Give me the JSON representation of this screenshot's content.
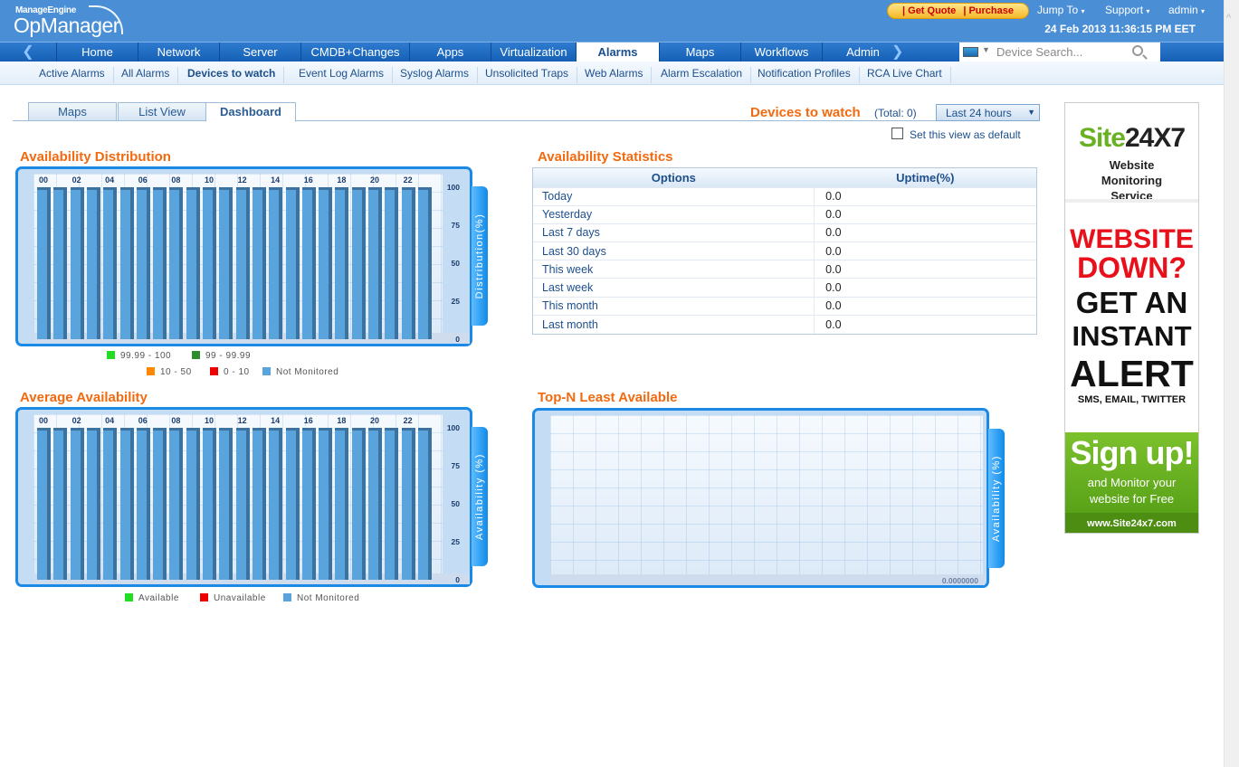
{
  "header": {
    "brand_small": "ManageEngine",
    "brand": "OpManager",
    "get_quote": "| Get Quote",
    "purchase": "| Purchase",
    "jump_to": "Jump To",
    "support": "Support",
    "user": "admin",
    "datetime": "24 Feb 2013 11:36:15 PM EET"
  },
  "nav": {
    "items": [
      "Home",
      "Network",
      "Server",
      "CMDB+Changes",
      "Apps",
      "Virtualization",
      "Alarms",
      "Maps",
      "Workflows",
      "Admin"
    ],
    "active": "Alarms",
    "search_placeholder": "Device Search..."
  },
  "subnav": {
    "items": [
      "Active Alarms",
      "All Alarms",
      "Devices to watch",
      "Event Log Alarms",
      "Syslog Alarms",
      "Unsolicited Traps",
      "Web Alarms",
      "Alarm Escalation",
      "Notification Profiles",
      "RCA Live Chart"
    ],
    "active": "Devices to watch"
  },
  "tabs": {
    "items": [
      "Maps",
      "List View",
      "Dashboard"
    ],
    "active": "Dashboard"
  },
  "page": {
    "title": "Devices to watch",
    "total": "(Total: 0)",
    "range": "Last 24 hours",
    "default_label": "Set this view as default",
    "default_checked": false
  },
  "sections": {
    "dist": "Availability Distribution",
    "stats": "Availability Statistics",
    "avg": "Average Availability",
    "topn": "Top-N Least Available"
  },
  "stats": {
    "headers": [
      "Options",
      "Uptime(%)"
    ],
    "rows": [
      [
        "Today",
        "0.0"
      ],
      [
        "Yesterday",
        "0.0"
      ],
      [
        "Last 7 days",
        "0.0"
      ],
      [
        "Last 30 days",
        "0.0"
      ],
      [
        "This week",
        "0.0"
      ],
      [
        "Last week",
        "0.0"
      ],
      [
        "This month",
        "0.0"
      ],
      [
        "Last month",
        "0.0"
      ]
    ]
  },
  "chart_data": [
    {
      "type": "bar",
      "title": "Availability Distribution",
      "ylabel": "Distribution(%)",
      "ylim": [
        0,
        100
      ],
      "yticks": [
        "100",
        "75",
        "50",
        "25",
        "0"
      ],
      "categories": [
        "00",
        "01",
        "02",
        "03",
        "04",
        "05",
        "06",
        "07",
        "08",
        "09",
        "10",
        "11",
        "12",
        "13",
        "14",
        "15",
        "16",
        "17",
        "18",
        "19",
        "20",
        "21",
        "22",
        "23"
      ],
      "xtick_labels": [
        "00",
        "02",
        "04",
        "06",
        "08",
        "10",
        "12",
        "14",
        "16",
        "18",
        "20",
        "22"
      ],
      "series": [
        {
          "name": "Not Monitored",
          "color": "#59a4dc",
          "values": [
            100,
            100,
            100,
            100,
            100,
            100,
            100,
            100,
            100,
            100,
            100,
            100,
            100,
            100,
            100,
            100,
            100,
            100,
            100,
            100,
            100,
            100,
            100,
            100
          ]
        }
      ],
      "legend": [
        {
          "label": "99.99 - 100",
          "color": "#22dd22"
        },
        {
          "label": "99 - 99.99",
          "color": "#2e8b2e"
        },
        {
          "label": "10 - 50",
          "color": "#ff8800"
        },
        {
          "label": "0 - 10",
          "color": "#ee0000"
        },
        {
          "label": "Not Monitored",
          "color": "#59a4dc"
        }
      ]
    },
    {
      "type": "bar",
      "title": "Average Availability",
      "ylabel": "Availability (%)",
      "ylim": [
        0,
        100
      ],
      "yticks": [
        "100",
        "75",
        "50",
        "25",
        "0"
      ],
      "categories": [
        "00",
        "01",
        "02",
        "03",
        "04",
        "05",
        "06",
        "07",
        "08",
        "09",
        "10",
        "11",
        "12",
        "13",
        "14",
        "15",
        "16",
        "17",
        "18",
        "19",
        "20",
        "21",
        "22",
        "23"
      ],
      "xtick_labels": [
        "00",
        "02",
        "04",
        "06",
        "08",
        "10",
        "12",
        "14",
        "16",
        "18",
        "20",
        "22"
      ],
      "series": [
        {
          "name": "Not Monitored",
          "color": "#59a4dc",
          "values": [
            100,
            100,
            100,
            100,
            100,
            100,
            100,
            100,
            100,
            100,
            100,
            100,
            100,
            100,
            100,
            100,
            100,
            100,
            100,
            100,
            100,
            100,
            100,
            100
          ]
        }
      ],
      "legend": [
        {
          "label": "Available",
          "color": "#22dd22"
        },
        {
          "label": "Unavailable",
          "color": "#ee0000"
        },
        {
          "label": "Not Monitored",
          "color": "#59a4dc"
        }
      ]
    },
    {
      "type": "bar",
      "title": "Top-N Least Available",
      "ylabel": "Availability (%)",
      "yticks": [
        "0.0000000"
      ],
      "categories": [],
      "values": []
    }
  ],
  "ad": {
    "brand": "Site24X7",
    "tagline": "Website Monitoring Service",
    "l1": "WEBSITE",
    "l2": "DOWN?",
    "l3": "GET AN",
    "l4": "INSTANT",
    "l5": "ALERT",
    "l6": "SMS, EMAIL, TWITTER",
    "signup": "Sign up!",
    "sub1": "and Monitor your",
    "sub2": "website for Free",
    "url": "www.Site24x7.com"
  }
}
